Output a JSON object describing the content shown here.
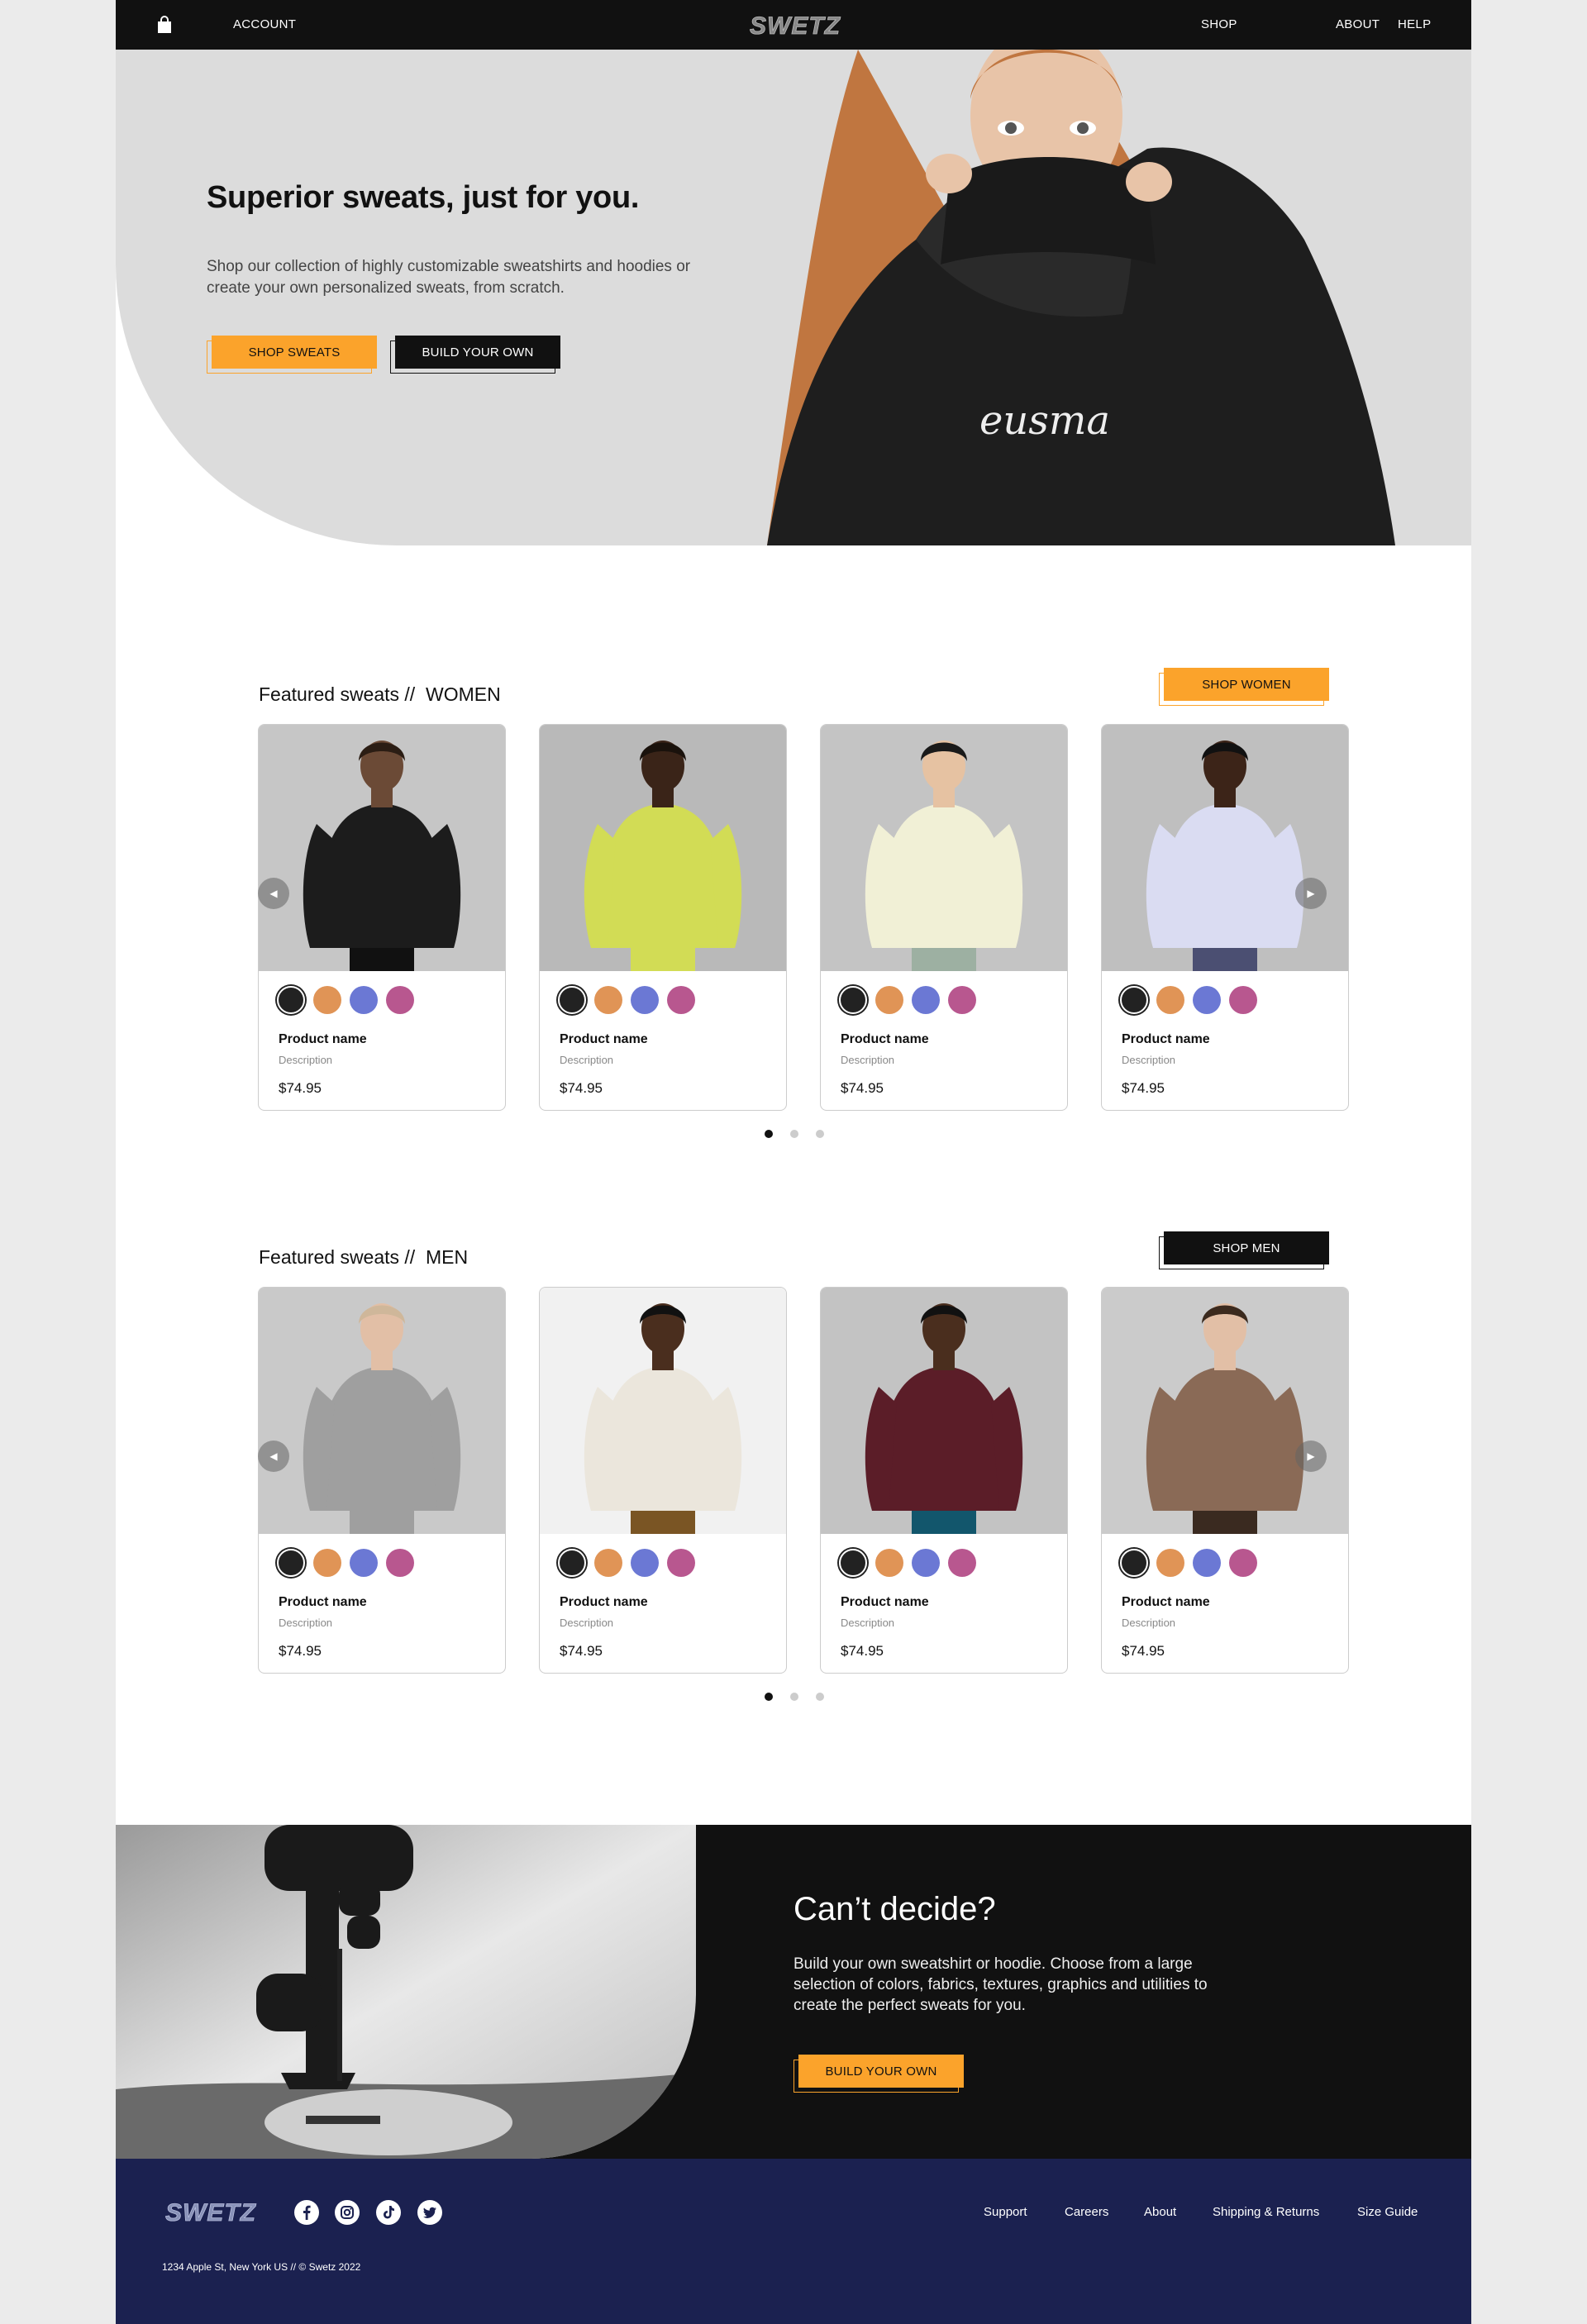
{
  "nav": {
    "account": "ACCOUNT",
    "shop": "SHOP",
    "about": "ABOUT",
    "help": "HELP",
    "logo": "SWETZ",
    "bag_icon": "shopping-bag-icon"
  },
  "hero": {
    "title": "Superior sweats, just for you.",
    "description": "Shop our collection of highly customizable sweatshirts and hoodies or create your own personalized sweats, from scratch.",
    "shop_button": "SHOP SWEATS",
    "build_button": "BUILD YOUR OWN",
    "sweatshirt_print": "eusma"
  },
  "women": {
    "title_prefix": "Featured sweats //",
    "title_category": "WOMEN",
    "button": "SHOP WOMEN",
    "products": [
      {
        "name": "Product name",
        "description": "Description",
        "price": "$74.95"
      },
      {
        "name": "Product name",
        "description": "Description",
        "price": "$74.95"
      },
      {
        "name": "Product name",
        "description": "Description",
        "price": "$74.95"
      },
      {
        "name": "Product name",
        "description": "Description",
        "price": "$74.95"
      }
    ],
    "pages": 3,
    "active_page": 1
  },
  "men": {
    "title_prefix": "Featured sweats //",
    "title_category": "MEN",
    "button": "SHOP MEN",
    "products": [
      {
        "name": "Product name",
        "description": "Description",
        "price": "$74.95"
      },
      {
        "name": "Product name",
        "description": "Description",
        "price": "$74.95"
      },
      {
        "name": "Product name",
        "description": "Description",
        "price": "$74.95"
      },
      {
        "name": "Product name",
        "description": "Description",
        "price": "$74.95"
      }
    ],
    "pages": 3,
    "active_page": 1
  },
  "swatches": [
    "#222222",
    "#e09456",
    "#6b78d4",
    "#b8578f"
  ],
  "decide": {
    "title": "Can’t decide?",
    "description": "Build your own sweatshirt or hoodie. Choose from a large selection of colors, fabrics, textures, graphics and utilities to create the perfect sweats for you.",
    "button": "BUILD YOUR OWN"
  },
  "footer": {
    "logo": "SWETZ",
    "social_icons": [
      "facebook-icon",
      "instagram-icon",
      "tiktok-icon",
      "twitter-icon"
    ],
    "links": [
      "Support",
      "Careers",
      "About",
      "Shipping & Returns",
      "Size Guide"
    ],
    "address": "1234 Apple St, New York US  //  © Swetz 2022"
  },
  "colors": {
    "accent": "#fba32b",
    "dark": "#111111",
    "footer": "#1b2150",
    "hero_bg": "#dcdcdc"
  }
}
